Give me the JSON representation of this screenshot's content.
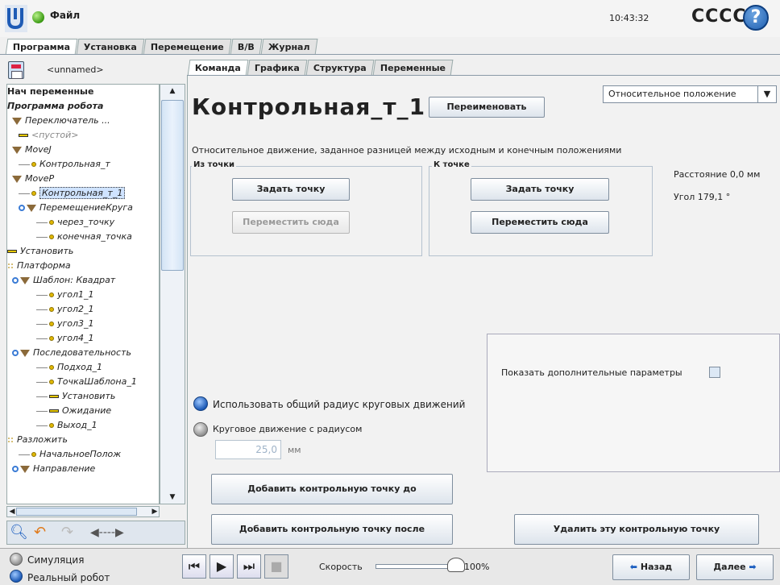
{
  "header": {
    "file_menu": "Файл",
    "clock": "10:43:32",
    "robot_name": "CCCC",
    "help": "?"
  },
  "main_tabs": [
    {
      "label": "Программа",
      "active": true
    },
    {
      "label": "Установка",
      "active": false
    },
    {
      "label": "Перемещение",
      "active": false
    },
    {
      "label": "В/В",
      "active": false
    },
    {
      "label": "Журнал",
      "active": false
    }
  ],
  "program": {
    "name": "<unnamed>"
  },
  "tree": [
    {
      "text": "Нач переменные",
      "style": "bold-plain",
      "icon": "none"
    },
    {
      "text": "Программа робота",
      "style": "bold",
      "icon": "none"
    },
    {
      "text": "Переключатель ...",
      "icon": "triangle"
    },
    {
      "text": "<пустой>",
      "icon": "bar"
    },
    {
      "text": "MoveJ",
      "icon": "triangle"
    },
    {
      "text": "Контрольная_т",
      "icon": "dot"
    },
    {
      "text": "MoveP",
      "icon": "triangle"
    },
    {
      "text": "Контрольная_т_1",
      "icon": "dot",
      "selected": true
    },
    {
      "text": "ПеремещениеКруга",
      "icon": "triangle"
    },
    {
      "text": "через_точку",
      "icon": "dot"
    },
    {
      "text": "конечная_точка",
      "icon": "dot"
    },
    {
      "text": "Установить",
      "icon": "bar"
    },
    {
      "text": "Платформа",
      "icon": "fork"
    },
    {
      "text": "Шаблон: Квадрат",
      "icon": "triangle"
    },
    {
      "text": "угол1_1",
      "icon": "dot"
    },
    {
      "text": "угол2_1",
      "icon": "dot"
    },
    {
      "text": "угол3_1",
      "icon": "dot"
    },
    {
      "text": "угол4_1",
      "icon": "dot"
    },
    {
      "text": "Последовательность",
      "icon": "triangle"
    },
    {
      "text": "Подход_1",
      "icon": "dot"
    },
    {
      "text": "ТочкаШаблона_1",
      "icon": "dot"
    },
    {
      "text": "Установить",
      "icon": "bar"
    },
    {
      "text": "Ожидание",
      "icon": "bar"
    },
    {
      "text": "Выход_1",
      "icon": "dot"
    },
    {
      "text": "Разложить",
      "icon": "fork"
    },
    {
      "text": "НачальноеПолож",
      "icon": "dot"
    },
    {
      "text": "Направление",
      "icon": "triangle"
    }
  ],
  "sub_tabs": [
    {
      "label": "Команда",
      "active": true
    },
    {
      "label": "Графика",
      "active": false
    },
    {
      "label": "Структура",
      "active": false
    },
    {
      "label": "Переменные",
      "active": false
    }
  ],
  "command": {
    "title": "Контрольная_т_1",
    "rename_button": "Переименовать",
    "position_mode": "Относительное положение",
    "description": "Относительное движение, заданное разницей между исходным и конечным положениями",
    "from_group": {
      "label": "Из точки",
      "set_button": "Задать точку",
      "move_button": "Переместить сюда"
    },
    "to_group": {
      "label": "К точке",
      "set_button": "Задать точку",
      "move_button": "Переместить сюда"
    },
    "distance": "Расстояние 0,0 мм",
    "angle": "Угол 179,1 °",
    "advanced_label": "Показать дополнительные параметры",
    "radio_shared": "Использовать общий радиус круговых движений",
    "radio_radius": "Круговое движение с радиусом",
    "radius_value": "25,0",
    "radius_unit": "мм",
    "add_before": "Добавить контрольную точку до",
    "add_after": "Добавить контрольную точку после",
    "delete": "Удалить эту контрольную точку"
  },
  "footer": {
    "simulation": "Симуляция",
    "real_robot": "Реальный робот",
    "speed_label": "Скорость",
    "speed_value": "100%",
    "speed_fraction": 1.0,
    "back": "Назад",
    "next": "Далее"
  }
}
